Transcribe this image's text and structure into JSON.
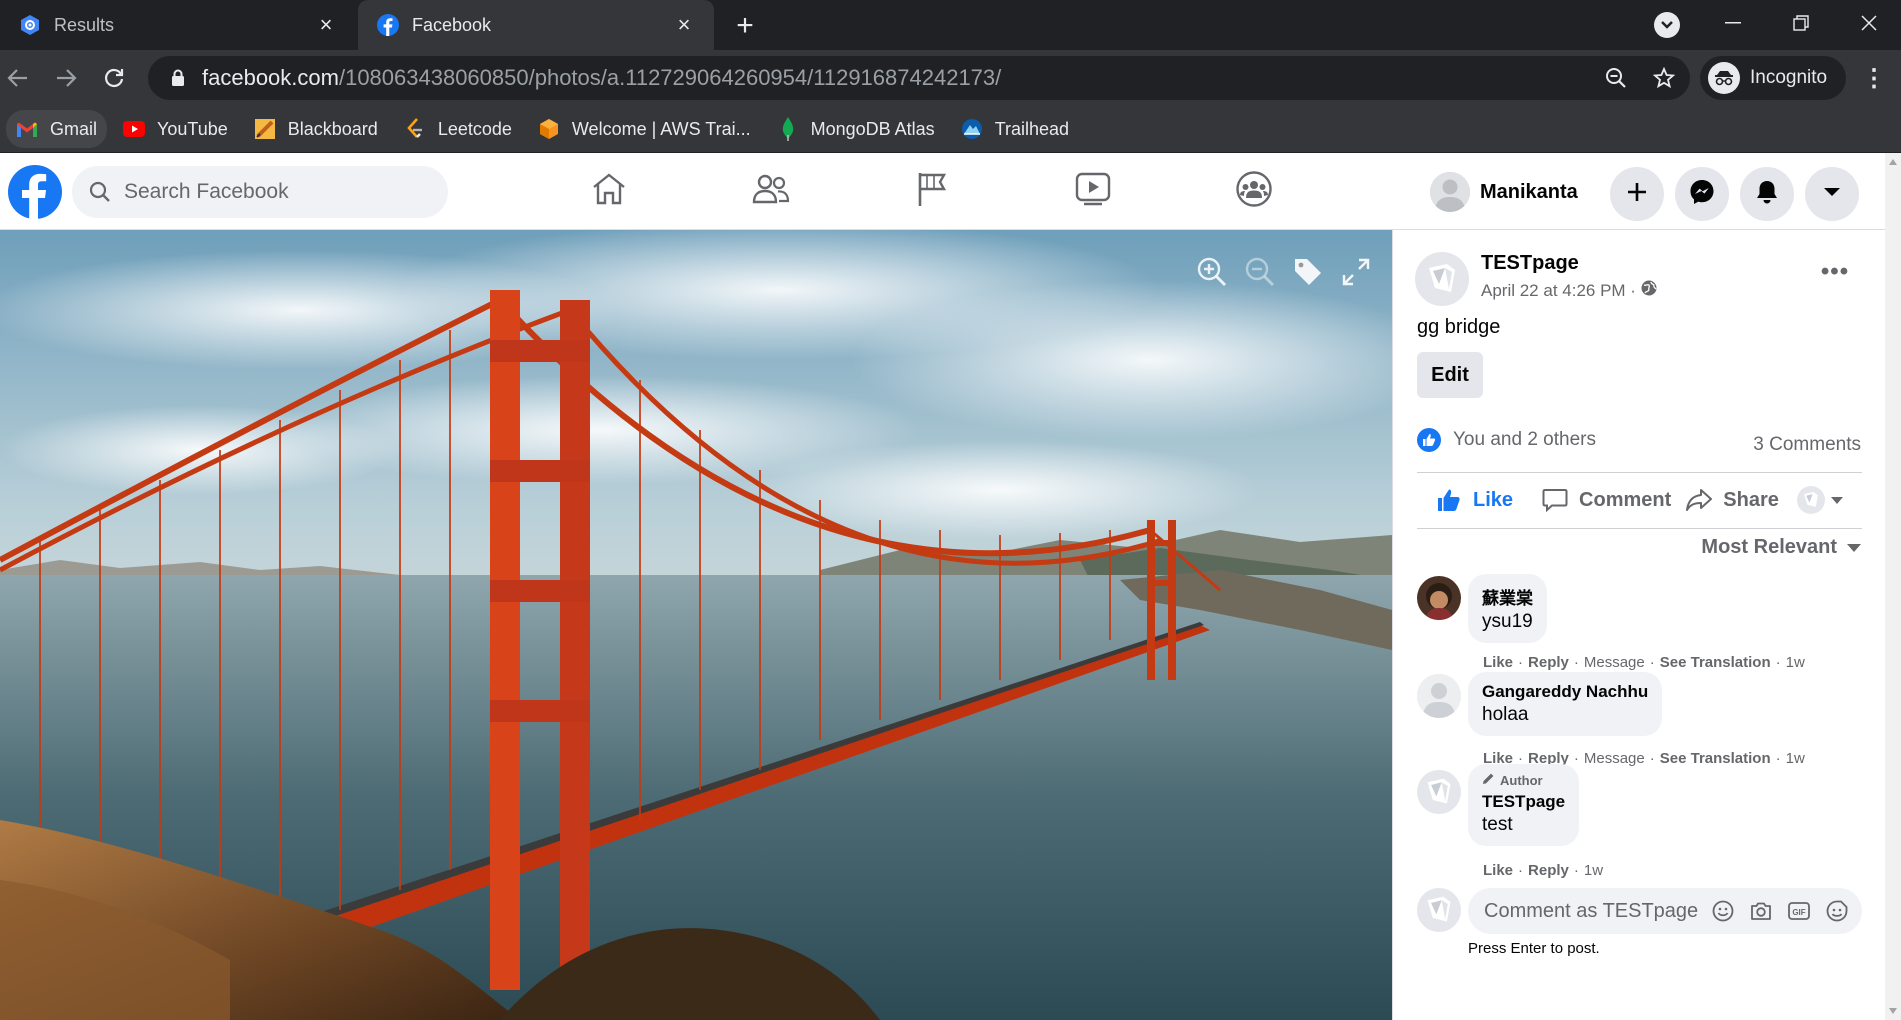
{
  "browser": {
    "tabs": [
      {
        "title": "Results",
        "icon": "google-results-icon",
        "active": false
      },
      {
        "title": "Facebook",
        "icon": "facebook-icon",
        "active": true
      }
    ],
    "url_host": "facebook.com",
    "url_path": "/108063438060850/photos/a.112729064260954/112916874242173/",
    "profile_label": "Incognito",
    "bookmarks": [
      {
        "label": "Gmail",
        "icon": "gmail-icon"
      },
      {
        "label": "YouTube",
        "icon": "youtube-icon"
      },
      {
        "label": "Blackboard",
        "icon": "blackboard-icon"
      },
      {
        "label": "Leetcode",
        "icon": "leetcode-icon"
      },
      {
        "label": "Welcome | AWS Trai...",
        "icon": "aws-icon"
      },
      {
        "label": "MongoDB Atlas",
        "icon": "mongodb-icon"
      },
      {
        "label": "Trailhead",
        "icon": "trailhead-icon"
      }
    ]
  },
  "facebook": {
    "search_placeholder": "Search Facebook",
    "user_name": "Manikanta",
    "brand_color": "#1877f2"
  },
  "post": {
    "page_name": "TESTpage",
    "timestamp": "April 22 at 4:26 PM ·",
    "text": "gg bridge",
    "edit_label": "Edit",
    "reactions_text": "You and 2 others",
    "comments_count": "3 Comments",
    "actions": {
      "like": "Like",
      "comment": "Comment",
      "share": "Share"
    },
    "sort_label": "Most Relevant"
  },
  "comments": [
    {
      "name": "蘇業棠",
      "text": "ysu19",
      "like": "Like",
      "reply": "Reply",
      "message": "Message",
      "translate": "See Translation",
      "age": "1w"
    },
    {
      "name": "Gangareddy Nachhu",
      "text": "holaa",
      "like": "Like",
      "reply": "Reply",
      "message": "Message",
      "translate": "See Translation",
      "age": "1w"
    },
    {
      "badge": "Author",
      "name": "TESTpage",
      "text": "test",
      "like": "Like",
      "reply": "Reply",
      "age": "1w"
    }
  ],
  "composer": {
    "placeholder": "Comment as TESTpage",
    "hint": "Press Enter to post."
  }
}
